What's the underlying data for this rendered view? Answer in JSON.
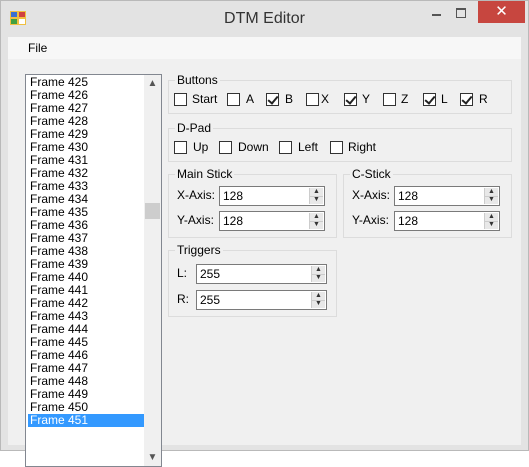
{
  "window": {
    "title": "DTM Editor",
    "close_glyph": "✕"
  },
  "menu": {
    "file": "File"
  },
  "frames": {
    "items": [
      "Frame 425",
      "Frame 426",
      "Frame 427",
      "Frame 428",
      "Frame 429",
      "Frame 430",
      "Frame 431",
      "Frame 432",
      "Frame 433",
      "Frame 434",
      "Frame 435",
      "Frame 436",
      "Frame 437",
      "Frame 438",
      "Frame 439",
      "Frame 440",
      "Frame 441",
      "Frame 442",
      "Frame 443",
      "Frame 444",
      "Frame 445",
      "Frame 446",
      "Frame 447",
      "Frame 448",
      "Frame 449",
      "Frame 450",
      "Frame 451"
    ],
    "selected": "Frame 451"
  },
  "buttons": {
    "label": "Buttons",
    "items": [
      {
        "label": "Start",
        "checked": false
      },
      {
        "label": "A",
        "checked": false
      },
      {
        "label": "B",
        "checked": true
      },
      {
        "label": "X",
        "checked": false
      },
      {
        "label": "Y",
        "checked": true
      },
      {
        "label": "Z",
        "checked": false
      },
      {
        "label": "L",
        "checked": true
      },
      {
        "label": "R",
        "checked": true
      }
    ]
  },
  "dpad": {
    "label": "D-Pad",
    "items": [
      {
        "label": "Up",
        "checked": false
      },
      {
        "label": "Down",
        "checked": false
      },
      {
        "label": "Left",
        "checked": false
      },
      {
        "label": "Right",
        "checked": false
      }
    ]
  },
  "main_stick": {
    "label": "Main Stick",
    "x_label": "X-Axis:",
    "x_value": "128",
    "y_label": "Y-Axis:",
    "y_value": "128"
  },
  "c_stick": {
    "label": "C-Stick",
    "x_label": "X-Axis:",
    "x_value": "128",
    "y_label": "Y-Axis:",
    "y_value": "128"
  },
  "triggers": {
    "label": "Triggers",
    "l_label": "L:",
    "l_value": "255",
    "r_label": "R:",
    "r_value": "255"
  },
  "icons": {
    "spin_up": "▲",
    "spin_down": "▼",
    "scroll_up": "▲",
    "scroll_down": "▼"
  }
}
